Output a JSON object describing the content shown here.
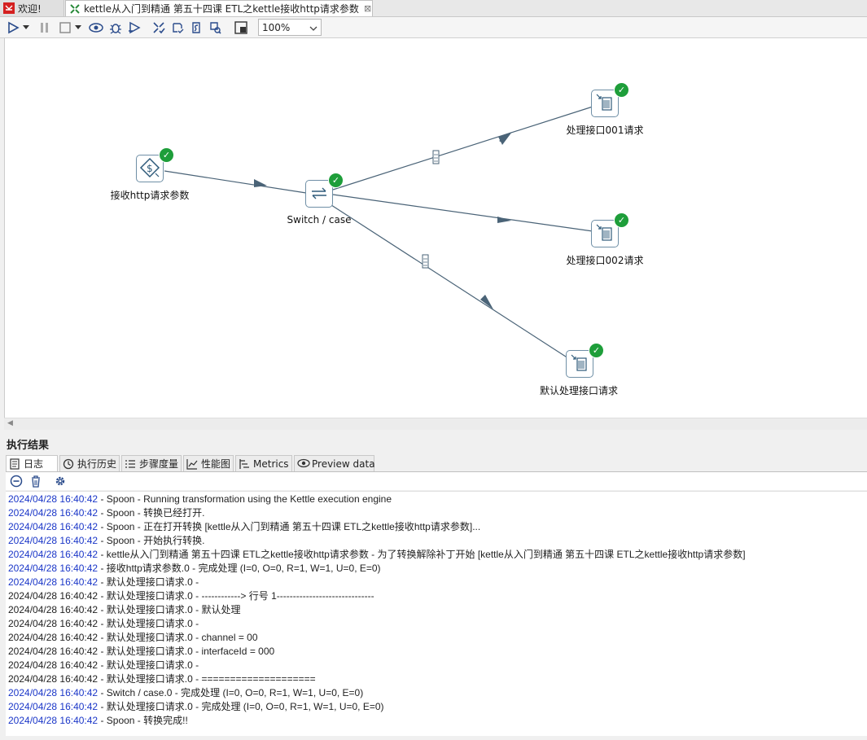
{
  "tabs": [
    {
      "label": "欢迎!",
      "icon": "spoon-welcome-icon"
    },
    {
      "label": "kettle从入门到精通 第五十四课 ETL之kettle接收http请求参数",
      "icon": "transformation-icon",
      "close": "⊠"
    }
  ],
  "toolbar": {
    "zoom": "100%",
    "icons": [
      "run-icon",
      "run-options-icon",
      "pause-icon",
      "stop-icon",
      "stop-options-icon",
      "preview-icon",
      "debug-icon",
      "replay-icon",
      "verify-icon",
      "impact-icon",
      "sql-icon",
      "explore-db-icon",
      "show-results-icon"
    ]
  },
  "steps": [
    {
      "label": "接收http请求参数",
      "icon": "http-receiver-icon"
    },
    {
      "label": "Switch / case",
      "icon": "switch-case-icon"
    },
    {
      "label": "处理接口001请求",
      "icon": "process-icon"
    },
    {
      "label": "处理接口002请求",
      "icon": "process-icon"
    },
    {
      "label": "默认处理接口请求",
      "icon": "process-icon"
    }
  ],
  "results": {
    "title": "执行结果",
    "tabs": [
      {
        "label": "日志",
        "icon": "log-icon"
      },
      {
        "label": "执行历史",
        "icon": "history-icon"
      },
      {
        "label": "步骤度量",
        "icon": "step-metrics-icon"
      },
      {
        "label": "性能图",
        "icon": "performance-icon"
      },
      {
        "label": "Metrics",
        "icon": "metrics-icon"
      },
      {
        "label": "Preview data",
        "icon": "preview-data-icon"
      }
    ],
    "log_lines": [
      {
        "ts": "2024/04/28 16:40:42",
        "text": " - Spoon - Running transformation using the Kettle execution engine",
        "blue": true
      },
      {
        "ts": "2024/04/28 16:40:42",
        "text": " - Spoon - 转换已经打开.",
        "blue": true
      },
      {
        "ts": "2024/04/28 16:40:42",
        "text": " - Spoon - 正在打开转换 [kettle从入门到精通 第五十四课 ETL之kettle接收http请求参数]...",
        "blue": true
      },
      {
        "ts": "2024/04/28 16:40:42",
        "text": " - Spoon - 开始执行转换.",
        "blue": true
      },
      {
        "ts": "2024/04/28 16:40:42",
        "text": " - kettle从入门到精通 第五十四课 ETL之kettle接收http请求参数 - 为了转换解除补丁开始  [kettle从入门到精通 第五十四课 ETL之kettle接收http请求参数]",
        "blue": true
      },
      {
        "ts": "2024/04/28 16:40:42",
        "text": " - 接收http请求参数.0 - 完成处理 (I=0, O=0, R=1, W=1, U=0, E=0)",
        "blue": true
      },
      {
        "ts": "2024/04/28 16:40:42",
        "text": " - 默认处理接口请求.0 - ",
        "blue": true
      },
      {
        "ts": "2024/04/28 16:40:42",
        "text": " - 默认处理接口请求.0 - ------------> 行号 1------------------------------",
        "blue": false
      },
      {
        "ts": "2024/04/28 16:40:42",
        "text": " - 默认处理接口请求.0 - 默认处理",
        "blue": false
      },
      {
        "ts": "2024/04/28 16:40:42",
        "text": " - 默认处理接口请求.0 - ",
        "blue": false
      },
      {
        "ts": "2024/04/28 16:40:42",
        "text": " - 默认处理接口请求.0 - channel = 00",
        "blue": false
      },
      {
        "ts": "2024/04/28 16:40:42",
        "text": " - 默认处理接口请求.0 - interfaceId = 000",
        "blue": false
      },
      {
        "ts": "2024/04/28 16:40:42",
        "text": " - 默认处理接口请求.0 - ",
        "blue": false
      },
      {
        "ts": "2024/04/28 16:40:42",
        "text": " - 默认处理接口请求.0 - ====================",
        "blue": false
      },
      {
        "ts": "2024/04/28 16:40:42",
        "text": " - Switch / case.0 - 完成处理 (I=0, O=0, R=1, W=1, U=0, E=0)",
        "blue": true
      },
      {
        "ts": "2024/04/28 16:40:42",
        "text": " - 默认处理接口请求.0 - 完成处理 (I=0, O=0, R=1, W=1, U=0, E=0)",
        "blue": true
      },
      {
        "ts": "2024/04/28 16:40:42",
        "text": " - Spoon - 转换完成!!",
        "blue": true
      }
    ]
  },
  "colors": {
    "hop": "#4a6377",
    "success": "#1e9e3a",
    "timestamp": "#1a36c8"
  }
}
